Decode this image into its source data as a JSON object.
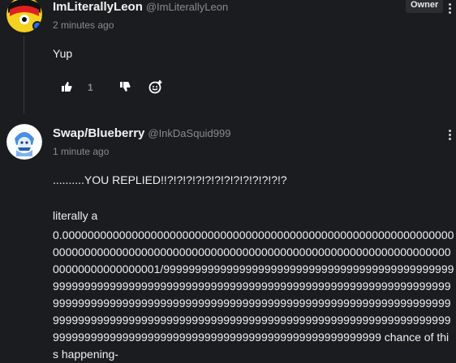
{
  "comments": [
    {
      "author": "ImLiterallyLeon",
      "handle": "@ImLiterallyLeon",
      "time": "2 minutes ago",
      "badge": "Owner",
      "text": "Yup",
      "likes": "1"
    },
    {
      "author": "Swap/Blueberry",
      "handle": "@InkDaSquid999",
      "time": "1 minute ago",
      "line1": "..........YOU REPLIED!!?!?!?!?!?!?!?!?!?!?!?!?!?",
      "line2": "literally a",
      "long_text": "0.0000000000000000000000000000000000000000000000000000000000000000000000000000000000000000000000000000000000000000000000000000000000000000000001/99999999999999999999999999999999999999999999999999999999999999999999999999999999999999999999999999999999999999999999999999999999999999999999999999999999999999999999999999999999999999999999999999999999999999999999999999999999999999999999999999999999999999999999999999999999999999999999999 chance of this happening-"
    }
  ],
  "colors": {
    "background": "#1b1c1f",
    "muted": "#8a8b90"
  }
}
